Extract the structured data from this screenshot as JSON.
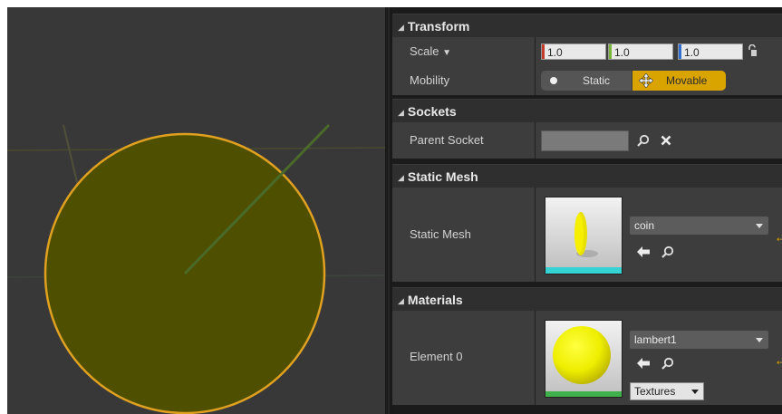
{
  "viewport": {
    "sphere_fill": "#4f4f00",
    "sphere_outline": "#e0a020"
  },
  "transform": {
    "header": "Transform",
    "scale_label": "Scale",
    "scale_x": "1.0",
    "scale_y": "1.0",
    "scale_z": "1.0",
    "mobility_label": "Mobility",
    "mobility_static": "Static",
    "mobility_movable": "Movable",
    "mobility_selected": "Movable"
  },
  "sockets": {
    "header": "Sockets",
    "parent_socket_label": "Parent Socket",
    "parent_socket_value": ""
  },
  "static_mesh": {
    "header": "Static Mesh",
    "label": "Static Mesh",
    "asset_name": "coin"
  },
  "materials": {
    "header": "Materials",
    "element_label": "Element 0",
    "material_name": "lambert1",
    "textures_button": "Textures"
  },
  "colors": {
    "accent": "#d9a300",
    "axis_x": "#c23a2a",
    "axis_y": "#7ab33a",
    "axis_z": "#2f6fd0"
  }
}
